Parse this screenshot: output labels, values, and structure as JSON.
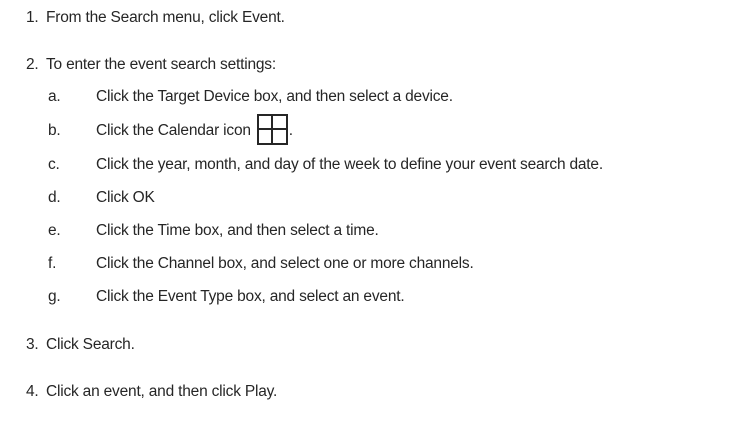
{
  "steps": [
    {
      "number": "1.",
      "text": "From the Search menu, click Event."
    },
    {
      "number": "2.",
      "text": "To enter the event search settings:"
    },
    {
      "number": "3.",
      "text": "Click Search."
    },
    {
      "number": "4.",
      "text": "Click an event, and then click Play."
    }
  ],
  "substeps": [
    {
      "letter": "a.",
      "text": "Click the Target Device box, and then select a device."
    },
    {
      "letter": "b.",
      "text": "Click the Calendar icon",
      "suffix": "."
    },
    {
      "letter": "c.",
      "text": "Click the year, month, and day of the week to define your event search date."
    },
    {
      "letter": "d.",
      "text": "Click OK"
    },
    {
      "letter": "e.",
      "text": "Click the Time box, and then select a time."
    },
    {
      "letter": "f.",
      "text": "Click the Channel box, and select one or more channels."
    },
    {
      "letter": "g.",
      "text": "Click the Event Type box, and select an event."
    }
  ],
  "icons": {
    "calendar": "calendar-icon"
  }
}
